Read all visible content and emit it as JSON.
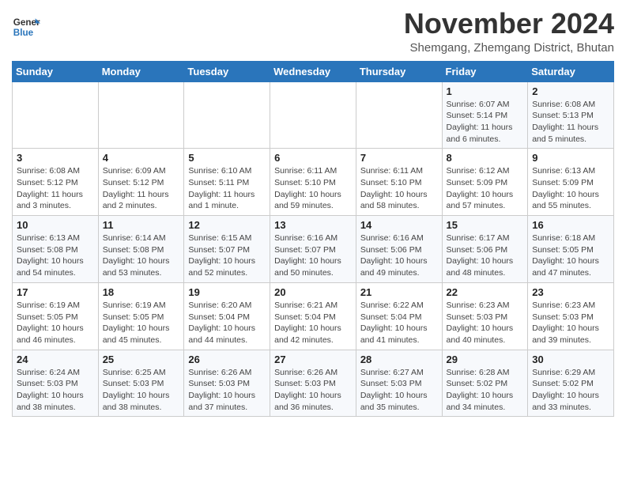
{
  "header": {
    "logo_line1": "General",
    "logo_line2": "Blue",
    "title": "November 2024",
    "subtitle": "Shemgang, Zhemgang District, Bhutan"
  },
  "weekdays": [
    "Sunday",
    "Monday",
    "Tuesday",
    "Wednesday",
    "Thursday",
    "Friday",
    "Saturday"
  ],
  "weeks": [
    [
      {
        "day": "",
        "info": ""
      },
      {
        "day": "",
        "info": ""
      },
      {
        "day": "",
        "info": ""
      },
      {
        "day": "",
        "info": ""
      },
      {
        "day": "",
        "info": ""
      },
      {
        "day": "1",
        "info": "Sunrise: 6:07 AM\nSunset: 5:14 PM\nDaylight: 11 hours\nand 6 minutes."
      },
      {
        "day": "2",
        "info": "Sunrise: 6:08 AM\nSunset: 5:13 PM\nDaylight: 11 hours\nand 5 minutes."
      }
    ],
    [
      {
        "day": "3",
        "info": "Sunrise: 6:08 AM\nSunset: 5:12 PM\nDaylight: 11 hours\nand 3 minutes."
      },
      {
        "day": "4",
        "info": "Sunrise: 6:09 AM\nSunset: 5:12 PM\nDaylight: 11 hours\nand 2 minutes."
      },
      {
        "day": "5",
        "info": "Sunrise: 6:10 AM\nSunset: 5:11 PM\nDaylight: 11 hours\nand 1 minute."
      },
      {
        "day": "6",
        "info": "Sunrise: 6:11 AM\nSunset: 5:10 PM\nDaylight: 10 hours\nand 59 minutes."
      },
      {
        "day": "7",
        "info": "Sunrise: 6:11 AM\nSunset: 5:10 PM\nDaylight: 10 hours\nand 58 minutes."
      },
      {
        "day": "8",
        "info": "Sunrise: 6:12 AM\nSunset: 5:09 PM\nDaylight: 10 hours\nand 57 minutes."
      },
      {
        "day": "9",
        "info": "Sunrise: 6:13 AM\nSunset: 5:09 PM\nDaylight: 10 hours\nand 55 minutes."
      }
    ],
    [
      {
        "day": "10",
        "info": "Sunrise: 6:13 AM\nSunset: 5:08 PM\nDaylight: 10 hours\nand 54 minutes."
      },
      {
        "day": "11",
        "info": "Sunrise: 6:14 AM\nSunset: 5:08 PM\nDaylight: 10 hours\nand 53 minutes."
      },
      {
        "day": "12",
        "info": "Sunrise: 6:15 AM\nSunset: 5:07 PM\nDaylight: 10 hours\nand 52 minutes."
      },
      {
        "day": "13",
        "info": "Sunrise: 6:16 AM\nSunset: 5:07 PM\nDaylight: 10 hours\nand 50 minutes."
      },
      {
        "day": "14",
        "info": "Sunrise: 6:16 AM\nSunset: 5:06 PM\nDaylight: 10 hours\nand 49 minutes."
      },
      {
        "day": "15",
        "info": "Sunrise: 6:17 AM\nSunset: 5:06 PM\nDaylight: 10 hours\nand 48 minutes."
      },
      {
        "day": "16",
        "info": "Sunrise: 6:18 AM\nSunset: 5:05 PM\nDaylight: 10 hours\nand 47 minutes."
      }
    ],
    [
      {
        "day": "17",
        "info": "Sunrise: 6:19 AM\nSunset: 5:05 PM\nDaylight: 10 hours\nand 46 minutes."
      },
      {
        "day": "18",
        "info": "Sunrise: 6:19 AM\nSunset: 5:05 PM\nDaylight: 10 hours\nand 45 minutes."
      },
      {
        "day": "19",
        "info": "Sunrise: 6:20 AM\nSunset: 5:04 PM\nDaylight: 10 hours\nand 44 minutes."
      },
      {
        "day": "20",
        "info": "Sunrise: 6:21 AM\nSunset: 5:04 PM\nDaylight: 10 hours\nand 42 minutes."
      },
      {
        "day": "21",
        "info": "Sunrise: 6:22 AM\nSunset: 5:04 PM\nDaylight: 10 hours\nand 41 minutes."
      },
      {
        "day": "22",
        "info": "Sunrise: 6:23 AM\nSunset: 5:03 PM\nDaylight: 10 hours\nand 40 minutes."
      },
      {
        "day": "23",
        "info": "Sunrise: 6:23 AM\nSunset: 5:03 PM\nDaylight: 10 hours\nand 39 minutes."
      }
    ],
    [
      {
        "day": "24",
        "info": "Sunrise: 6:24 AM\nSunset: 5:03 PM\nDaylight: 10 hours\nand 38 minutes."
      },
      {
        "day": "25",
        "info": "Sunrise: 6:25 AM\nSunset: 5:03 PM\nDaylight: 10 hours\nand 38 minutes."
      },
      {
        "day": "26",
        "info": "Sunrise: 6:26 AM\nSunset: 5:03 PM\nDaylight: 10 hours\nand 37 minutes."
      },
      {
        "day": "27",
        "info": "Sunrise: 6:26 AM\nSunset: 5:03 PM\nDaylight: 10 hours\nand 36 minutes."
      },
      {
        "day": "28",
        "info": "Sunrise: 6:27 AM\nSunset: 5:03 PM\nDaylight: 10 hours\nand 35 minutes."
      },
      {
        "day": "29",
        "info": "Sunrise: 6:28 AM\nSunset: 5:02 PM\nDaylight: 10 hours\nand 34 minutes."
      },
      {
        "day": "30",
        "info": "Sunrise: 6:29 AM\nSunset: 5:02 PM\nDaylight: 10 hours\nand 33 minutes."
      }
    ]
  ]
}
